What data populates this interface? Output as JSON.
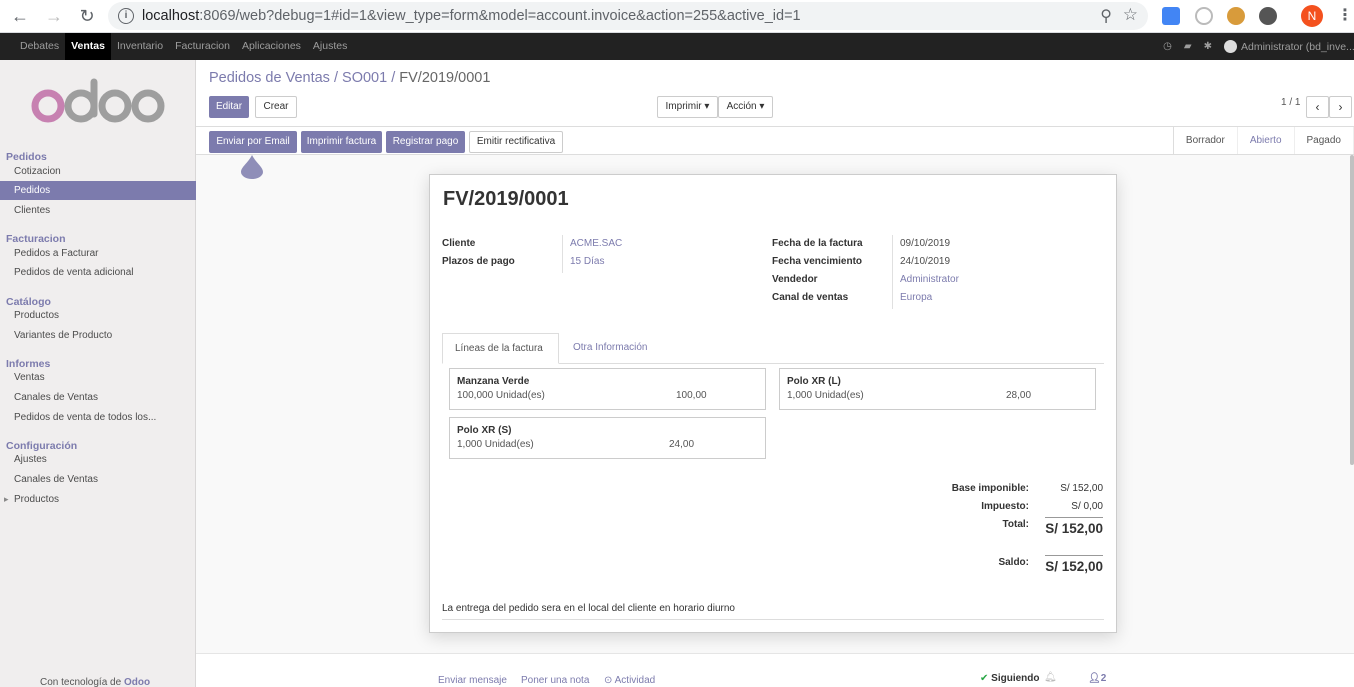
{
  "browser": {
    "url_host": "localhost",
    "url_rest": ":8069/web?debug=1#id=1&view_type=form&model=account.invoice&action=255&active_id=1",
    "profile_initial": "N"
  },
  "topbar": {
    "menus": [
      "Debates",
      "Ventas",
      "Inventario",
      "Facturacion",
      "Aplicaciones",
      "Ajustes"
    ],
    "active_menu": "Ventas",
    "user": "Administrator (bd_inve..."
  },
  "sidebar": {
    "sections": [
      {
        "title": "Pedidos",
        "items": [
          "Cotizacion",
          "Pedidos",
          "Clientes"
        ]
      },
      {
        "title": "Facturacion",
        "items": [
          "Pedidos a Facturar",
          "Pedidos de venta adicional"
        ]
      },
      {
        "title": "Catálogo",
        "items": [
          "Productos",
          "Variantes de Producto"
        ]
      },
      {
        "title": "Informes",
        "items": [
          "Ventas",
          "Canales de Ventas",
          "Pedidos de venta de todos los..."
        ]
      },
      {
        "title": "Configuración",
        "items": [
          "Ajustes",
          "Canales de Ventas",
          "Productos"
        ]
      }
    ],
    "active_item": "Pedidos",
    "footer_text": "Con tecnología de",
    "footer_brand": "Odoo"
  },
  "control_panel": {
    "breadcrumb": [
      "Pedidos de Ventas",
      "SO001",
      "FV/2019/0001"
    ],
    "edit_label": "Editar",
    "create_label": "Crear",
    "print_label": "Imprimir",
    "action_label": "Acción",
    "pager": "1 / 1"
  },
  "statusbar": {
    "buttons": [
      "Enviar por Email",
      "Imprimir factura",
      "Registrar pago",
      "Emitir rectificativa"
    ],
    "stages": [
      "Borrador",
      "Abierto",
      "Pagado"
    ],
    "active_stage": "Abierto"
  },
  "invoice": {
    "number": "FV/2019/0001",
    "left_fields": [
      {
        "label": "Cliente",
        "value": "ACME.SAC"
      },
      {
        "label": "Plazos de pago",
        "value": "15 Días"
      }
    ],
    "right_fields": [
      {
        "label": "Fecha de la factura",
        "value": "09/10/2019"
      },
      {
        "label": "Fecha vencimiento",
        "value": "24/10/2019"
      },
      {
        "label": "Vendedor",
        "value": "Administrator"
      },
      {
        "label": "Canal de ventas",
        "value": "Europa"
      }
    ],
    "tabs": [
      "Líneas de la factura",
      "Otra Información"
    ],
    "lines": [
      {
        "product": "Manzana Verde",
        "qty": "100,000 Unidad(es)",
        "amount": "100,00"
      },
      {
        "product": "Polo XR (L)",
        "qty": "1,000 Unidad(es)",
        "amount": "28,00"
      },
      {
        "product": "Polo XR (S)",
        "qty": "1,000 Unidad(es)",
        "amount": "24,00"
      }
    ],
    "totals": {
      "base_label": "Base imponible:",
      "base_value": "S/ 152,00",
      "tax_label": "Impuesto:",
      "tax_value": "S/ 0,00",
      "total_label": "Total:",
      "total_value": "S/ 152,00",
      "balance_label": "Saldo:",
      "balance_value": "S/ 152,00"
    },
    "note": "La entrega del pedido sera en el local del cliente en horario diurno"
  },
  "chatter": {
    "send_message": "Enviar mensaje",
    "log_note": "Poner una nota",
    "activity": "Actividad",
    "following": "Siguiendo",
    "followers_count": "2"
  },
  "colors": {
    "brand": "#7c7bad",
    "topbar": "#222222"
  }
}
